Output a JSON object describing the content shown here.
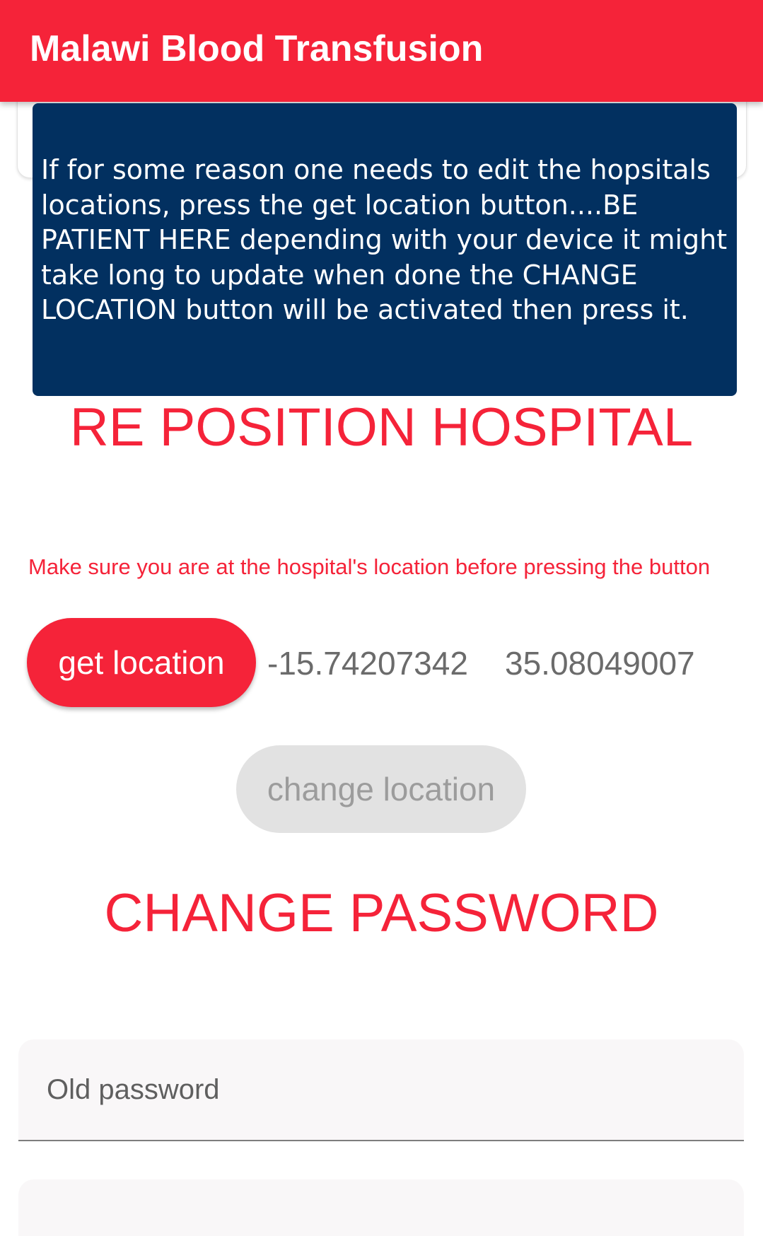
{
  "app_bar": {
    "title": "Malawi Blood Transfusion"
  },
  "tooltip": {
    "text": "If for some reason one needs to edit the hopsitals locations, press the get location button....BE PATIENT HERE depending with your device it might take long to update when done the CHANGE LOCATION button will be activated then press it."
  },
  "reposition": {
    "title": "RE POSITION HOSPITAL",
    "hint": "Make sure you are at the hospital's location before pressing the button",
    "get_location_label": "get location",
    "latitude": "-15.74207342",
    "longitude": "35.08049007",
    "change_location_label": "change location"
  },
  "password": {
    "title": "CHANGE PASSWORD",
    "old_placeholder": "Old password",
    "new_placeholder": ""
  },
  "colors": {
    "primary": "#f52339",
    "tooltip_bg": "#023060",
    "disabled_bg": "#e2e2e2",
    "disabled_text": "#9c9c9c",
    "field_bg": "#f9f7f8"
  }
}
